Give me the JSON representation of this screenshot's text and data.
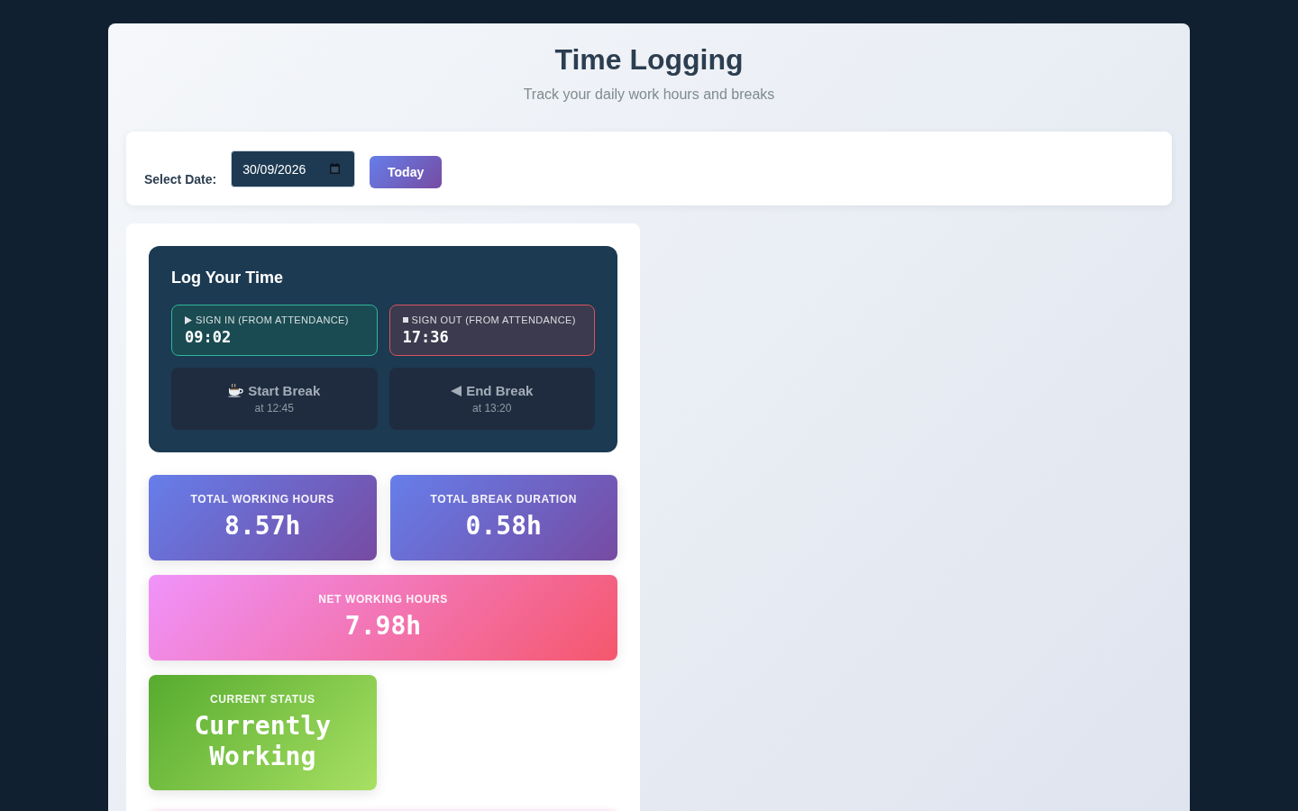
{
  "header": {
    "title": "Time Logging",
    "subtitle": "Track your daily work hours and breaks"
  },
  "date_bar": {
    "label": "Select Date:",
    "date_value": "30/09/2026",
    "today_button": "Today"
  },
  "log_card": {
    "title": "Log Your Time",
    "attendance": [
      {
        "kind": "sign_in",
        "label": "SIGN IN (FROM ATTENDANCE)",
        "time": "09:02"
      },
      {
        "kind": "sign_out",
        "label": "SIGN OUT (FROM ATTENDANCE)",
        "time": "17:36"
      }
    ],
    "breaks": [
      {
        "kind": "start",
        "label": "Start Break",
        "time": "at 12:45",
        "disabled": true
      },
      {
        "kind": "end",
        "label": "End Break",
        "time": "at 13:20",
        "disabled": true
      }
    ]
  },
  "stats": [
    {
      "kind": "total",
      "label": "TOTAL WORKING HOURS",
      "value": "8.57h"
    },
    {
      "kind": "break",
      "label": "TOTAL BREAK DURATION",
      "value": "0.58h"
    },
    {
      "kind": "net",
      "label": "NET WORKING HOURS",
      "value": "7.98h"
    },
    {
      "kind": "status",
      "label": "CURRENT STATUS",
      "value": "Currently Working"
    }
  ]
}
